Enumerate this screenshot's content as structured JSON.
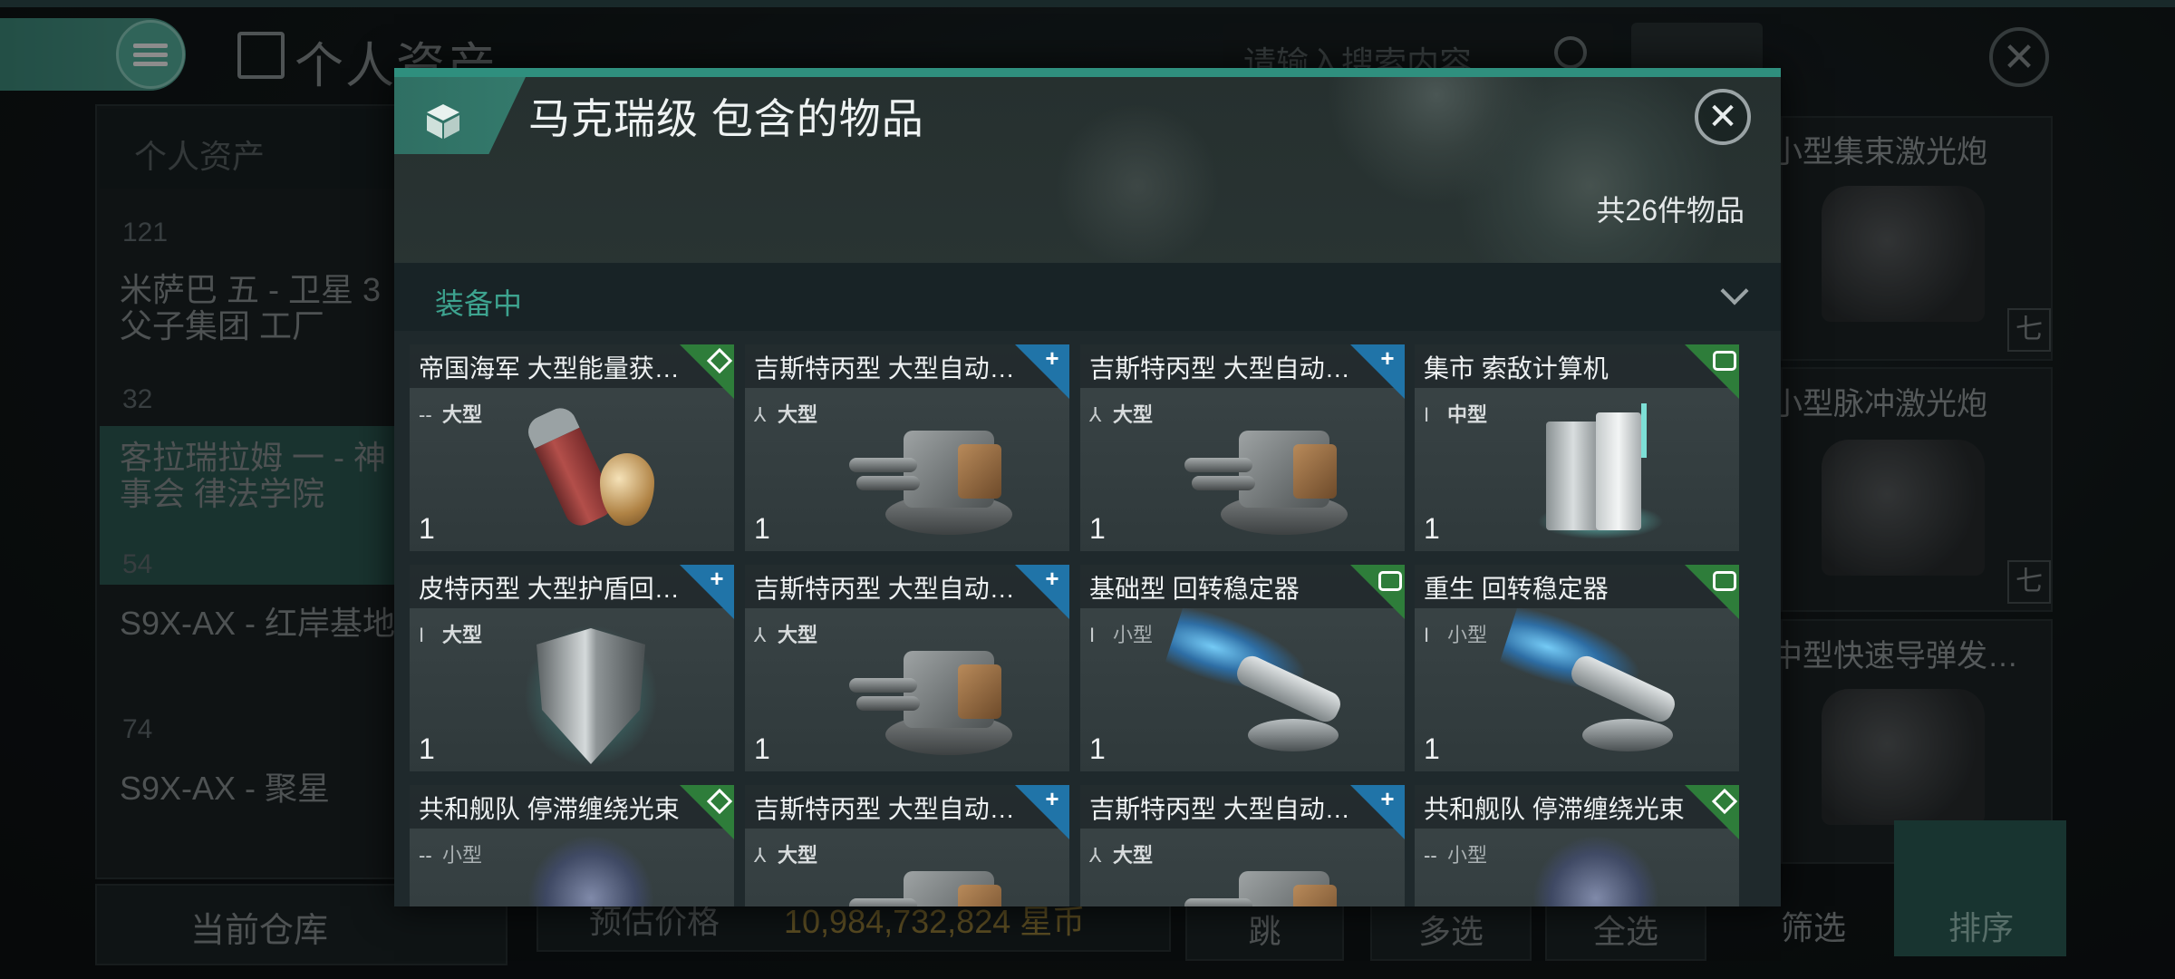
{
  "background": {
    "page_title": "个人资产",
    "search": {
      "placeholder": "请输入搜索内容"
    },
    "sidebar": {
      "header": "个人资产",
      "entries": [
        {
          "count": "121",
          "name_line1": "米萨巴 五 - 卫星 3",
          "name_line2": "父子集团 工厂"
        },
        {
          "count": "32",
          "name_line1": "客拉瑞拉姆 一 - 神",
          "name_line2": "事会 律法学院"
        },
        {
          "count": "54",
          "name_line1": "S9X-AX - 红岸基地",
          "name_line2": ""
        },
        {
          "count": "74",
          "name_line1": "S9X-AX - 聚星",
          "name_line2": ""
        }
      ],
      "footer_label": "当前仓库"
    },
    "right_cards": [
      {
        "label": "小型集束激光炮",
        "badge": "七"
      },
      {
        "label": "小型脉冲激光炮",
        "badge": "七"
      },
      {
        "label": "中型快速导弹发…",
        "badge": ""
      }
    ],
    "bottom_bar": {
      "price_label": "预估价格",
      "price_value": "10,984,732,824 星币",
      "jump_label": "跳",
      "multi_select": "多选",
      "select_all": "全选",
      "filter": "筛选",
      "sort": "排序"
    }
  },
  "modal": {
    "title": "马克瑞级 包含的物品",
    "item_count": "共26件物品",
    "section_label": "装备中",
    "items": [
      {
        "title": "帝国海军 大型能量获…",
        "badge": "green",
        "badge_icon": "diamond",
        "meta_symbol": "--",
        "size": "大型",
        "qty": "1",
        "art": "capsule"
      },
      {
        "title": "吉斯特丙型 大型自动加…",
        "badge": "blue",
        "badge_icon": "plus",
        "meta_symbol": "⅄",
        "size": "大型",
        "qty": "1",
        "art": "turret"
      },
      {
        "title": "吉斯特丙型 大型自动加…",
        "badge": "blue",
        "badge_icon": "plus",
        "meta_symbol": "⅄",
        "size": "大型",
        "qty": "1",
        "art": "turret"
      },
      {
        "title": "集市 索敌计算机",
        "badge": "green",
        "badge_icon": "ring",
        "meta_symbol": "I",
        "size": "中型",
        "qty": "1",
        "art": "computer"
      },
      {
        "title": "皮特丙型 大型护盾回…",
        "badge": "blue",
        "badge_icon": "plus",
        "meta_symbol": "I",
        "size": "大型",
        "qty": "1",
        "art": "shield"
      },
      {
        "title": "吉斯特丙型 大型自动加…",
        "badge": "blue",
        "badge_icon": "plus",
        "meta_symbol": "⅄",
        "size": "大型",
        "qty": "1",
        "art": "turret"
      },
      {
        "title": "基础型 回转稳定器",
        "badge": "green",
        "badge_icon": "ring",
        "meta_symbol": "I",
        "size": "小型",
        "qty": "1",
        "art": "stabilizer"
      },
      {
        "title": "重生 回转稳定器",
        "badge": "green",
        "badge_icon": "ring",
        "meta_symbol": "I",
        "size": "小型",
        "qty": "1",
        "art": "stabilizer"
      },
      {
        "title": "共和舰队 停滞缠绕光束",
        "badge": "green",
        "badge_icon": "diamond",
        "meta_symbol": "--",
        "size": "小型",
        "qty": "",
        "art": "web"
      },
      {
        "title": "吉斯特丙型 大型自动加…",
        "badge": "blue",
        "badge_icon": "plus",
        "meta_symbol": "⅄",
        "size": "大型",
        "qty": "",
        "art": "turret"
      },
      {
        "title": "吉斯特丙型 大型自动加…",
        "badge": "blue",
        "badge_icon": "plus",
        "meta_symbol": "⅄",
        "size": "大型",
        "qty": "",
        "art": "turret"
      },
      {
        "title": "共和舰队 停滞缠绕光束",
        "badge": "green",
        "badge_icon": "diamond",
        "meta_symbol": "--",
        "size": "小型",
        "qty": "",
        "art": "web"
      }
    ]
  }
}
